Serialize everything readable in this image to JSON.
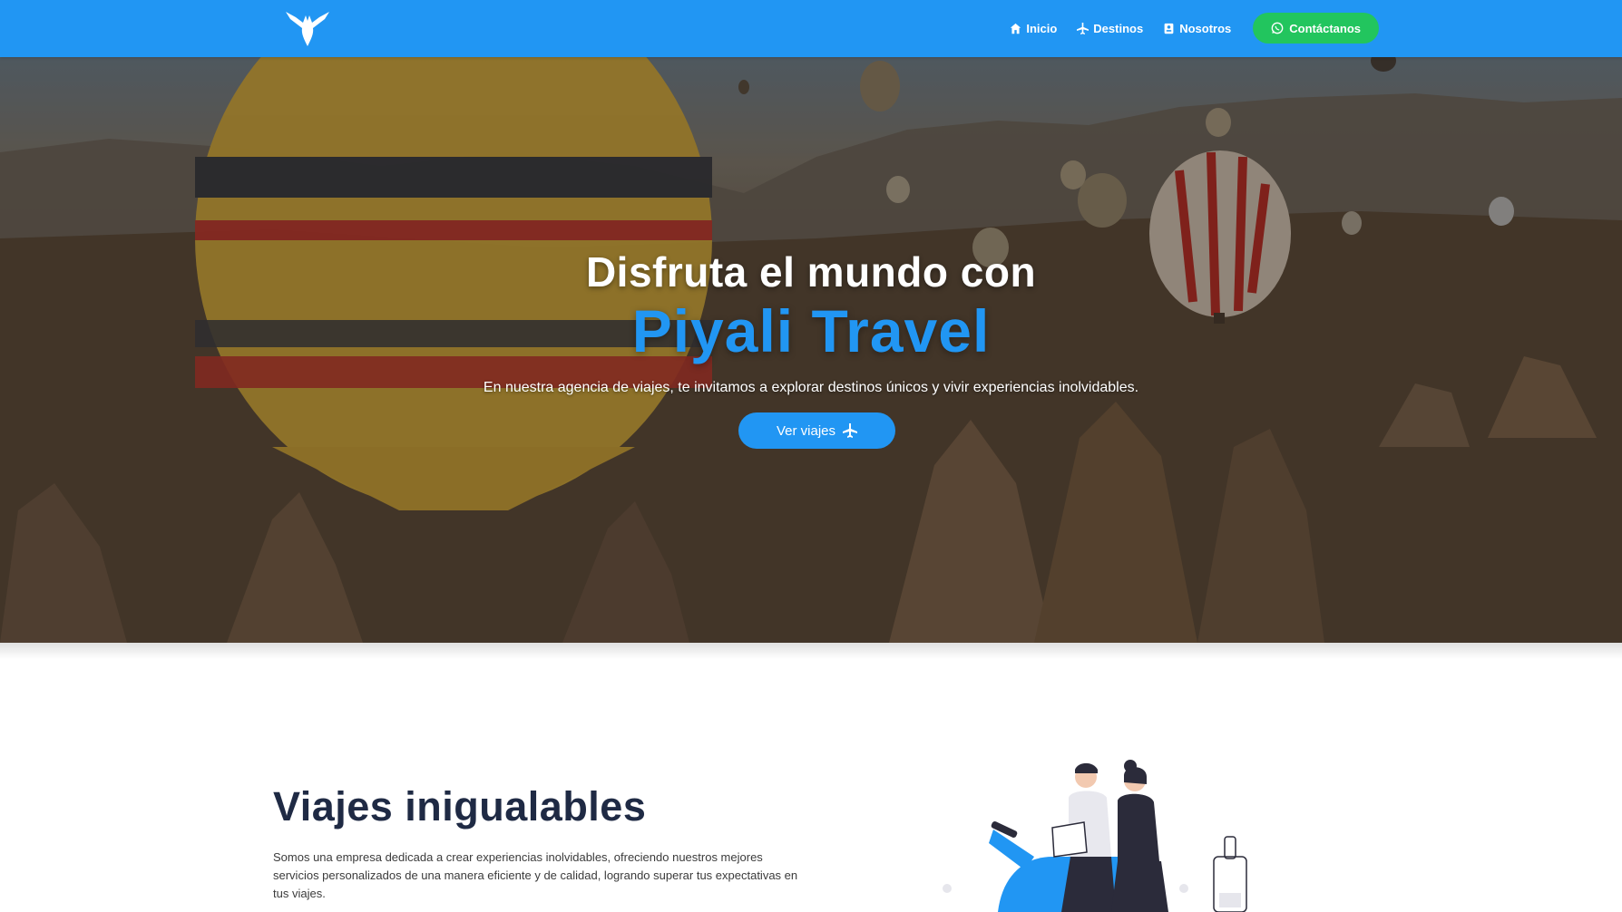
{
  "brand": {
    "primary_color": "#2196f3",
    "whatsapp_color": "#22c55e",
    "logo_icon": "bird-icon"
  },
  "nav": {
    "items": [
      {
        "label": "Inicio",
        "icon": "home-icon"
      },
      {
        "label": "Destinos",
        "icon": "plane-icon"
      },
      {
        "label": "Nosotros",
        "icon": "id-card-icon"
      }
    ],
    "contact": {
      "label": "Contáctanos",
      "icon": "whatsapp-icon"
    }
  },
  "hero": {
    "title_line1": "Disfruta el mundo con",
    "title_line2": "Piyali Travel",
    "subtitle": "En nuestra agencia de viajes, te invitamos a explorar destinos únicos y vivir experiencias inolvidables.",
    "cta": {
      "label": "Ver viajes",
      "icon": "plane-icon"
    },
    "background": "hot-air-balloons-landscape"
  },
  "about": {
    "title": "Viajes inigualables",
    "text": "Somos una empresa dedicada a crear experiencias inolvidables, ofreciendo nuestros mejores servicios personalizados de una manera eficiente y de calidad, logrando superar tus expectativas en tus viajes.",
    "illustration": "couple-on-scooter-illustration"
  }
}
